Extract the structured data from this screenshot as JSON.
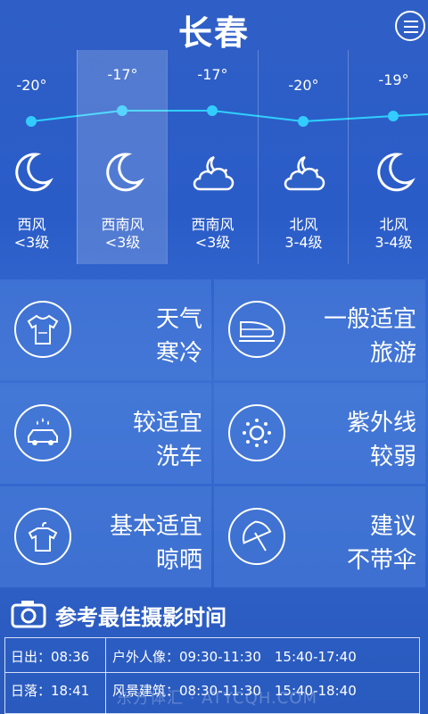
{
  "header": {
    "city": "长春"
  },
  "forecast": [
    {
      "temp": "-20°",
      "wind_dir": "西风",
      "wind_level": "<3级",
      "icon": "moon-icon"
    },
    {
      "temp": "-17°",
      "wind_dir": "西南风",
      "wind_level": "<3级",
      "icon": "moon-icon"
    },
    {
      "temp": "-17°",
      "wind_dir": "西南风",
      "wind_level": "<3级",
      "icon": "cloud-moon-icon"
    },
    {
      "temp": "-20°",
      "wind_dir": "北风",
      "wind_level": "3-4级",
      "icon": "cloud-moon-icon"
    },
    {
      "temp": "-19°",
      "wind_dir": "北风",
      "wind_level": "3-4级",
      "icon": "moon-icon"
    }
  ],
  "indices": [
    {
      "line1": "天气",
      "line2": "寒冷",
      "icon": "tshirt-icon"
    },
    {
      "line1": "一般适宜",
      "line2": "旅游",
      "icon": "train-icon"
    },
    {
      "line1": "较适宜",
      "line2": "洗车",
      "icon": "car-wash-icon"
    },
    {
      "line1": "紫外线",
      "line2": "较弱",
      "icon": "sun-icon"
    },
    {
      "line1": "基本适宜",
      "line2": "晾晒",
      "icon": "hanger-shirt-icon"
    },
    {
      "line1": "建议",
      "line2": "不带伞",
      "icon": "umbrella-icon"
    }
  ],
  "photo": {
    "title": "参考最佳摄影时间",
    "rows": [
      {
        "label": "日出：08:36",
        "value": "户外人像：09:30-11:30　15:40-17:40"
      },
      {
        "label": "日落：18:41",
        "value": "风景建筑：08:30-11:30　15:40-18:40"
      }
    ]
  },
  "watermark": "东方体汇 · ATYCQH.COM"
}
